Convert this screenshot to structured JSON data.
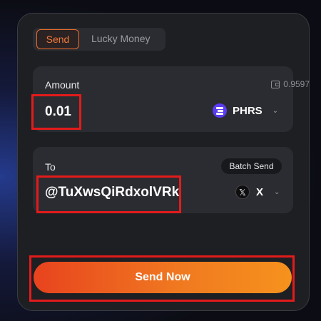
{
  "tabs": {
    "send": "Send",
    "lucky_money": "Lucky Money"
  },
  "amount": {
    "label": "Amount",
    "balance": "0.9597",
    "value": "0.01",
    "token": "PHRS"
  },
  "to": {
    "label": "To",
    "batch_send": "Batch Send",
    "value": "@TuXwsQiRdxolVRk",
    "network": "X"
  },
  "actions": {
    "send_now": "Send Now"
  },
  "colors": {
    "accent": "#f07a38",
    "button_start": "#e8431e",
    "button_end": "#f6921d",
    "highlight": "#e31b1b"
  }
}
